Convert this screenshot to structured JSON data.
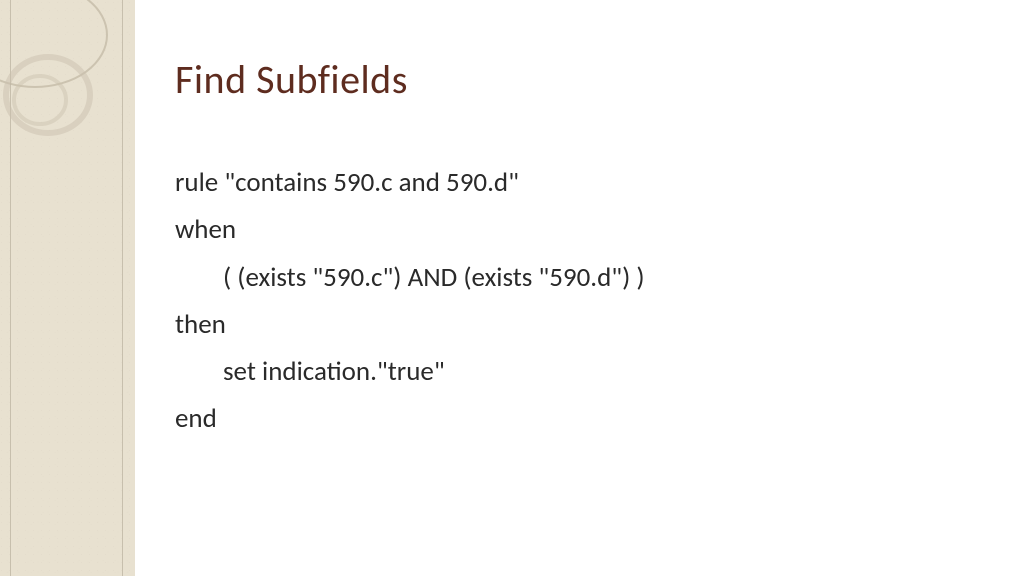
{
  "slide": {
    "title": "Find Subfields",
    "code": {
      "line1": "rule \"contains 590.c and 590.d\"",
      "line2": "when",
      "line3": "( (exists \"590.c\") AND (exists \"590.d\") )",
      "line4": "then",
      "line5": "set indication.\"true\"",
      "line6": "end"
    }
  }
}
